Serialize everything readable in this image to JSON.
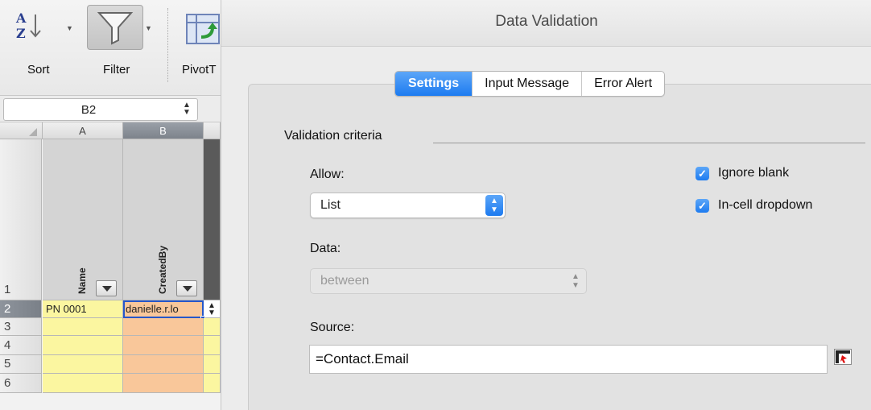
{
  "ribbon": {
    "sort_label": "Sort",
    "filter_label": "Filter",
    "pivot_label": "PivotT"
  },
  "namebox": {
    "value": "B2"
  },
  "grid": {
    "columns": [
      "A",
      "B"
    ],
    "rows": [
      "1",
      "2",
      "3",
      "4",
      "5",
      "6"
    ],
    "header_row": {
      "a": "Name",
      "b": "CreatedBy"
    },
    "row2": {
      "a": "PN 0001",
      "b": "danielle.r.lo"
    },
    "colors": {
      "yellow": "#fbf6a0",
      "orange": "#f9c79a",
      "selection": "#2757c9"
    }
  },
  "dialog": {
    "title": "Data Validation",
    "tabs": [
      {
        "label": "Settings",
        "active": true
      },
      {
        "label": "Input Message",
        "active": false
      },
      {
        "label": "Error Alert",
        "active": false
      }
    ],
    "section_title": "Validation criteria",
    "allow_label": "Allow:",
    "allow_value": "List",
    "ignore_blank": {
      "label": "Ignore blank",
      "checked": true
    },
    "in_cell_dropdown": {
      "label": "In-cell dropdown",
      "checked": true
    },
    "data_label": "Data:",
    "data_value": "between",
    "source_label": "Source:",
    "source_value": "=Contact.Email",
    "accent": "#1d7bf0"
  }
}
